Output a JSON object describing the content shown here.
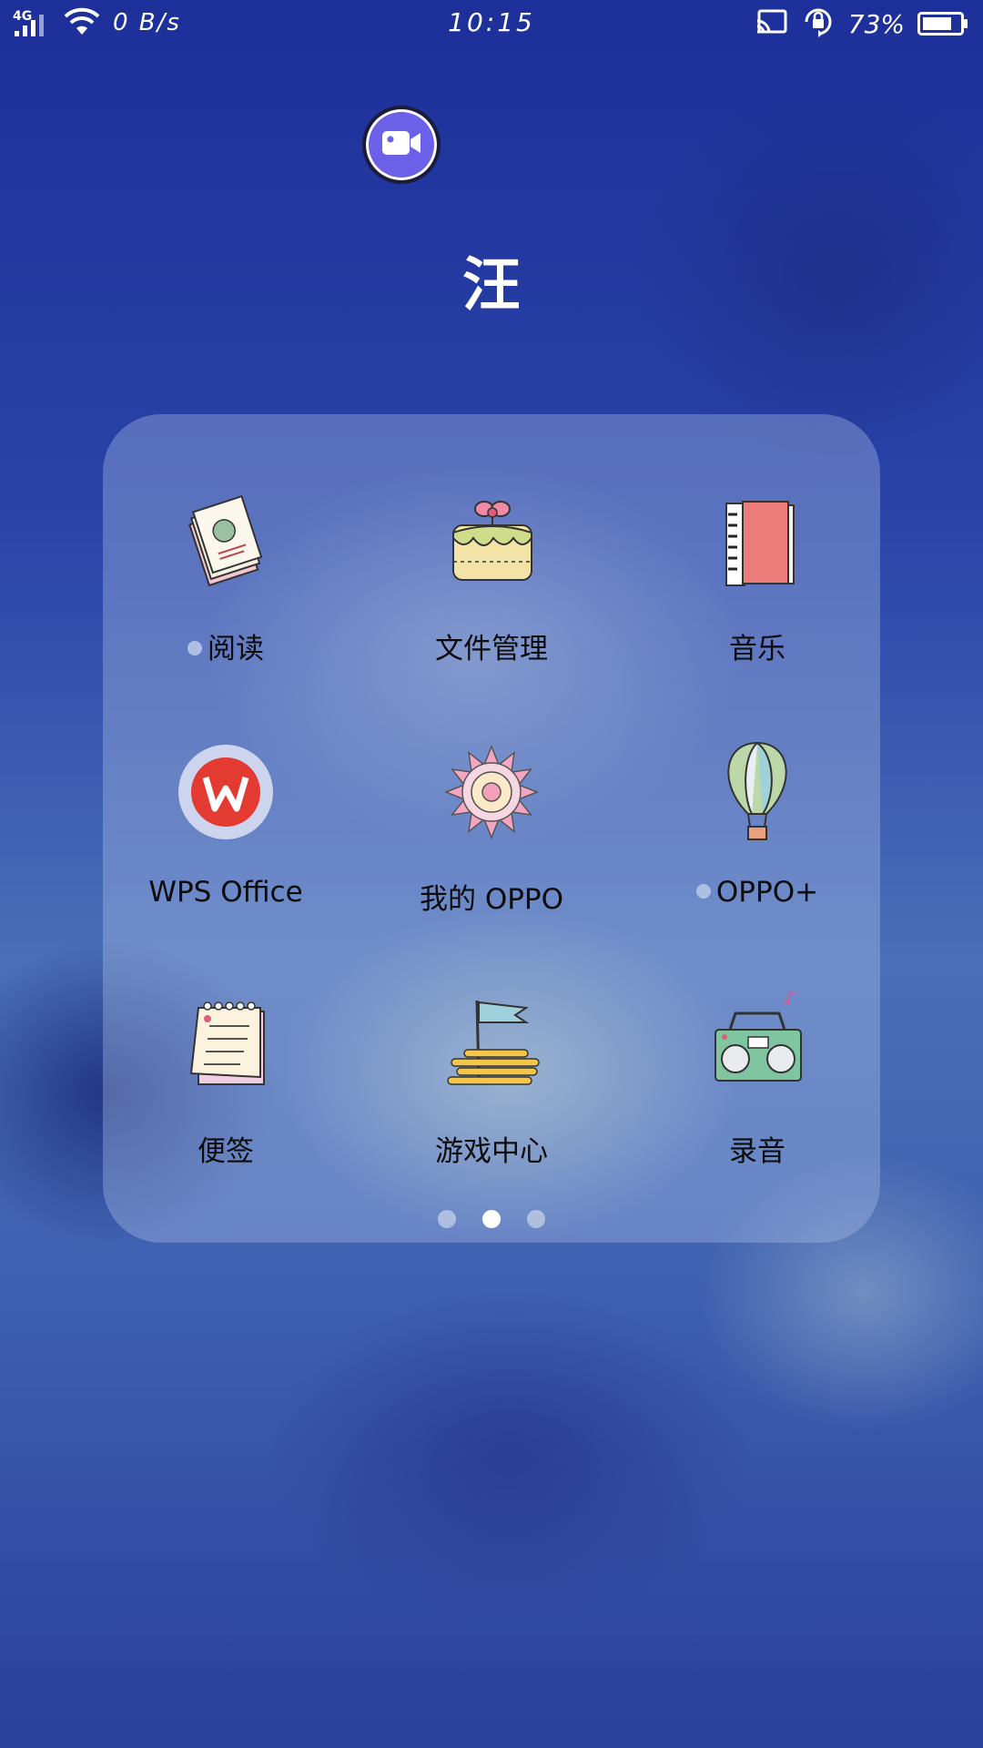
{
  "status_bar": {
    "network_type": "4G",
    "net_speed": "0 B/s",
    "time": "10:15",
    "battery_percent": "73%",
    "icons": [
      "signal-icon",
      "wifi-icon",
      "cast-icon",
      "rotation-lock-icon",
      "battery-icon"
    ]
  },
  "floating_button": {
    "icon": "video-camera-icon",
    "color": "#6c5fe8"
  },
  "folder": {
    "title": "汪",
    "apps": [
      {
        "label": "阅读",
        "icon": "books-icon",
        "has_new_dot": true
      },
      {
        "label": "文件管理",
        "icon": "cake-icon",
        "has_new_dot": false
      },
      {
        "label": "音乐",
        "icon": "piano-book-icon",
        "has_new_dot": false
      },
      {
        "label": "WPS Office",
        "icon": "wps-logo-icon",
        "has_new_dot": false
      },
      {
        "label": "我的 OPPO",
        "icon": "mandala-flower-icon",
        "has_new_dot": false
      },
      {
        "label": "OPPO+",
        "icon": "hot-air-balloon-icon",
        "has_new_dot": true
      },
      {
        "label": "便签",
        "icon": "notepad-icon",
        "has_new_dot": false
      },
      {
        "label": "游戏中心",
        "icon": "flag-sticks-icon",
        "has_new_dot": false
      },
      {
        "label": "录音",
        "icon": "boombox-icon",
        "has_new_dot": false
      }
    ],
    "page_count": 3,
    "active_page": 2
  }
}
